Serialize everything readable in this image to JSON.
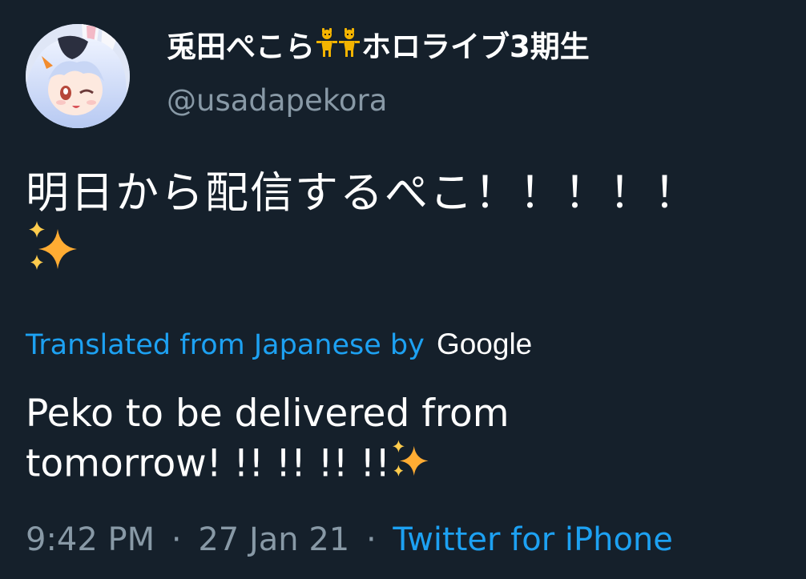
{
  "author": {
    "display_name": "兎田ぺこら",
    "display_name_suffix": "ホロライブ3期生",
    "handle": "@usadapekora",
    "emoji_icon": "dancing-women-icon"
  },
  "tweet": {
    "text_line1": "明日から配信するぺこ！！！！！",
    "sparkle_icon": "sparkles-icon"
  },
  "translation": {
    "label": "Translated from Japanese by",
    "provider": "Google",
    "text_line1": "Peko to be delivered from",
    "text_line2": "tomorrow! !! !! !! !!"
  },
  "meta": {
    "time": "9:42 PM",
    "separator": "·",
    "date": "27 Jan 21",
    "source": "Twitter for iPhone"
  },
  "colors": {
    "background": "#15202b",
    "accent": "#1da1f2",
    "secondary_text": "#8899a6",
    "sparkle": "#ffac33"
  }
}
